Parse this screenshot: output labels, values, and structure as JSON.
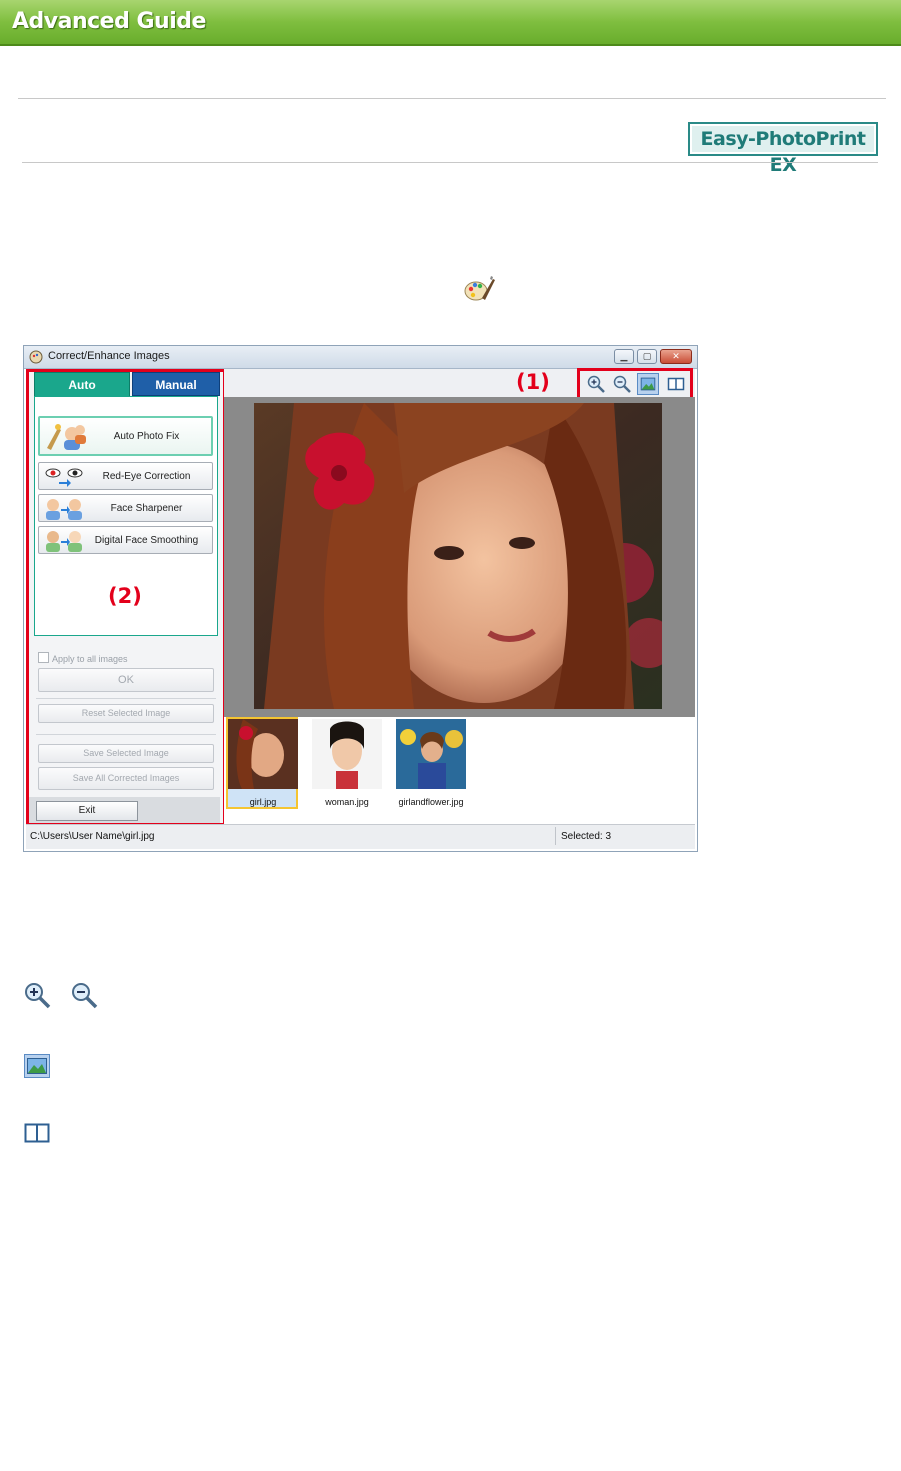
{
  "header": {
    "title": "Advanced Guide"
  },
  "product_logo": {
    "text": "Easy-PhotoPrint EX"
  },
  "window": {
    "title": "Correct/Enhance Images",
    "tabs": {
      "auto": "Auto",
      "manual": "Manual"
    },
    "buttons": {
      "auto_photo_fix": "Auto Photo Fix",
      "red_eye_correction": "Red-Eye Correction",
      "face_sharpener": "Face Sharpener",
      "digital_face_smoothing": "Digital Face Smoothing",
      "apply_to_all": "Apply to all images",
      "ok": "OK",
      "reset_selected": "Reset Selected Image",
      "save_selected": "Save Selected Image",
      "save_all": "Save All Corrected Images",
      "exit": "Exit"
    },
    "thumbnails": [
      "girl.jpg",
      "woman.jpg",
      "girlandflower.jpg"
    ],
    "status": {
      "path": "C:\\Users\\User Name\\girl.jpg",
      "selected": "Selected: 3"
    }
  },
  "callouts": {
    "toolbar": "(1)",
    "panel": "(2)"
  },
  "colors": {
    "banner": "#7fbe3f",
    "callout_red": "#e3001b",
    "auto_tab": "#1aa78c",
    "manual_tab": "#1f5fa8"
  }
}
